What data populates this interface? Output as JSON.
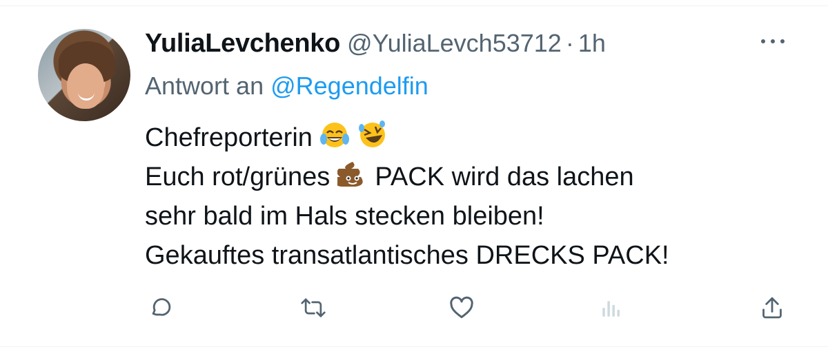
{
  "tweet": {
    "author": {
      "display_name": "YuliaLevchenko",
      "handle": "@YuliaLevch53712",
      "separator": "·",
      "time": "1h"
    },
    "reply_to": {
      "prefix": "Antwort an",
      "mention": "@Regendelfin"
    },
    "text": {
      "line1": "Chefreporterin",
      "line2_before": "Euch rot/grünes",
      "line2_after": "PACK wird das lachen",
      "line3": "sehr bald im Hals stecken bleiben!",
      "line4": "Gekauftes transatlantisches DRECKS PACK!"
    },
    "emojis": [
      "tears-of-joy-emoji",
      "rolling-laughing-emoji",
      "pile-of-poo-emoji"
    ]
  },
  "actions": [
    "reply-icon",
    "retweet-icon",
    "like-icon",
    "views-icon",
    "share-icon"
  ],
  "colors": {
    "text": "#0f1419",
    "muted": "#536471",
    "link": "#1d9bf0",
    "icon": "#536471",
    "icon_disabled": "#cfd9de"
  }
}
